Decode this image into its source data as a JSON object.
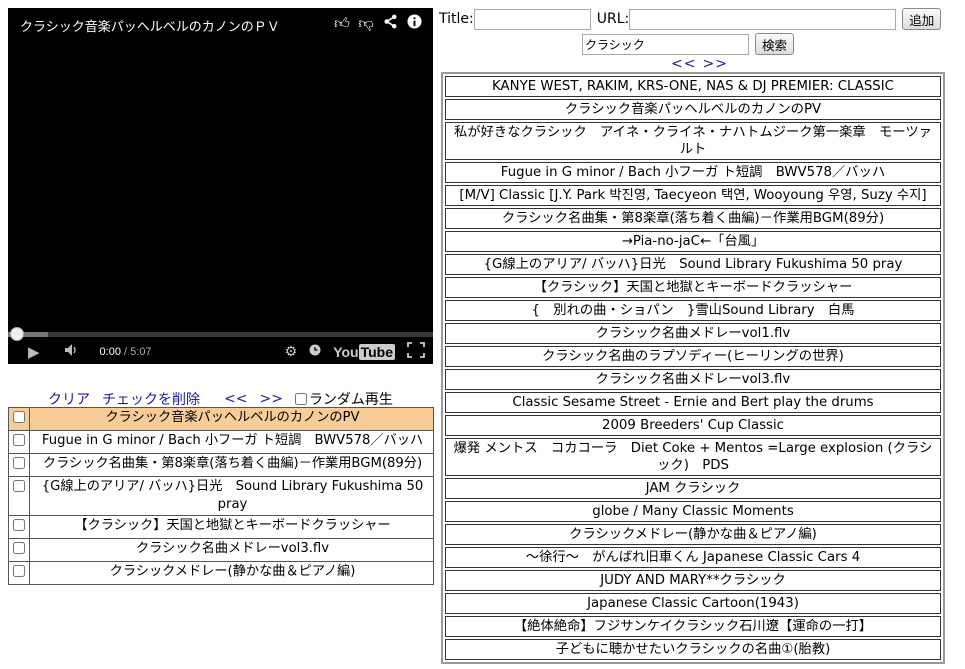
{
  "player": {
    "title": "クラシック音楽パッヘルベルのカノンのＰＶ",
    "icons": [
      "like-icon",
      "dislike-icon",
      "share-icon",
      "info-icon"
    ],
    "time_current": "0:00",
    "time_separator": " / ",
    "time_duration": "5:07",
    "progress": 0.0,
    "brand_you": "You",
    "brand_tube": "Tube"
  },
  "playlist_controls": {
    "clear": "クリア",
    "delete_checked": "チェックを削除",
    "prev": "<<",
    "next": ">>",
    "random_label": "ランダム再生"
  },
  "playlist": [
    {
      "title": "クラシック音楽パッヘルベルのカノンのPV",
      "active": true
    },
    {
      "title": "Fugue in G minor / Bach 小フーガ ト短調　BWV578／バッハ",
      "active": false
    },
    {
      "title": "クラシック名曲集・第8楽章(落ち着く曲編)－作業用BGM(89分)",
      "active": false
    },
    {
      "title": "{G線上のアリア/ バッハ}日光　Sound Library Fukushima 50 pray",
      "active": false
    },
    {
      "title": "【クラシック】天国と地獄とキーボードクラッシャー",
      "active": false
    },
    {
      "title": "クラシック名曲メドレーvol3.flv",
      "active": false
    },
    {
      "title": "クラシックメドレー(静かな曲＆ピアノ編)",
      "active": false
    }
  ],
  "add_form": {
    "title_label": "Title:",
    "title_value": "",
    "url_label": "URL:",
    "url_value": "",
    "add_button": "追加"
  },
  "search": {
    "value": "クラシック",
    "button": "検索"
  },
  "pager": {
    "prev": "<<",
    "next": ">>"
  },
  "results": [
    "KANYE WEST, RAKIM, KRS-ONE, NAS & DJ PREMIER: CLASSIC",
    "クラシック音楽パッヘルベルのカノンのPV",
    "私が好きなクラシック　アイネ・クライネ・ナハトムジーク第一楽章　モーツァルト",
    "Fugue in G minor / Bach 小フーガ ト短調　BWV578／バッハ",
    "[M/V] Classic [J.Y. Park 박진영, Taecyeon 택연, Wooyoung 우영, Suzy 수지]",
    "クラシック名曲集・第8楽章(落ち着く曲編)－作業用BGM(89分)",
    "→Pia-no-jaC←「台風」",
    "{G線上のアリア/ バッハ}日光　Sound Library Fukushima 50 pray",
    "【クラシック】天国と地獄とキーボードクラッシャー",
    "{　別れの曲・ショパン　}雪山Sound Library　白馬",
    "クラシック名曲メドレーvol1.flv",
    "クラシック名曲のラプソディー(ヒーリングの世界)",
    "クラシック名曲メドレーvol3.flv",
    "Classic Sesame Street - Ernie and Bert play the drums",
    "2009 Breeders' Cup Classic",
    "爆発 メントス　コカコーラ　Diet Coke + Mentos =Large explosion (クラシック)　PDS",
    "JAM クラシック",
    "globe / Many Classic Moments",
    "クラシックメドレー(静かな曲＆ピアノ編)",
    "～徐行～　がんばれ旧車くん Japanese Classic Cars 4",
    "JUDY AND MARY**クラシック",
    "Japanese Classic Cartoon(1943)",
    "【絶体絶命】フジサンケイクラシック石川遼【運命の一打】",
    "子どもに聴かせたいクラシックの名曲①(胎教)"
  ]
}
